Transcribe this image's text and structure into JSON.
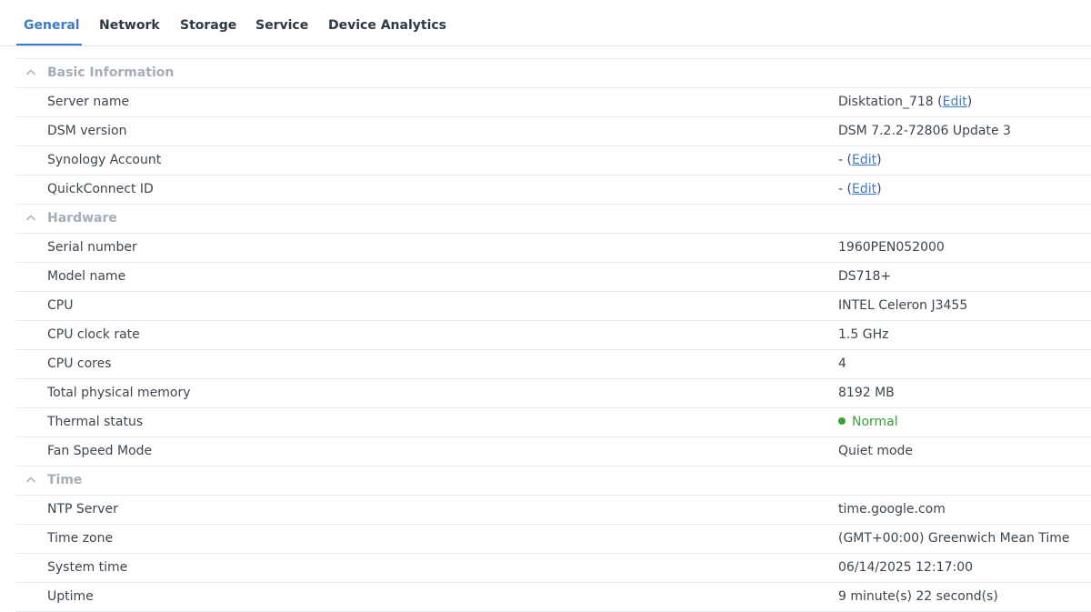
{
  "tabs": [
    {
      "label": "General",
      "active": true
    },
    {
      "label": "Network",
      "active": false
    },
    {
      "label": "Storage",
      "active": false
    },
    {
      "label": "Service",
      "active": false
    },
    {
      "label": "Device Analytics",
      "active": false
    }
  ],
  "icons": {
    "collapse": "chevron-up-icon",
    "status": "status-dot-icon"
  },
  "colors": {
    "accent": "#3d7bc4",
    "status_normal": "#3a9f3a",
    "section_title": "#a5adb5"
  },
  "sections": {
    "basic": {
      "title": "Basic Information",
      "rows": [
        {
          "label": "Server name",
          "value": "Disktation_718",
          "prefix": "(",
          "link": "Edit",
          "suffix": ")"
        },
        {
          "label": "DSM version",
          "value": "DSM 7.2.2-72806 Update 3"
        },
        {
          "label": "Synology Account",
          "value": "-",
          "prefix": "(",
          "link": "Edit",
          "suffix": ")"
        },
        {
          "label": "QuickConnect ID",
          "value": "-",
          "prefix": "(",
          "link": "Edit",
          "suffix": ")"
        }
      ]
    },
    "hardware": {
      "title": "Hardware",
      "rows": [
        {
          "label": "Serial number",
          "value": "1960PEN052000"
        },
        {
          "label": "Model name",
          "value": "DS718+"
        },
        {
          "label": "CPU",
          "value": "INTEL Celeron J3455"
        },
        {
          "label": "CPU clock rate",
          "value": "1.5 GHz"
        },
        {
          "label": "CPU cores",
          "value": "4"
        },
        {
          "label": "Total physical memory",
          "value": "8192 MB"
        },
        {
          "label": "Thermal status",
          "value": "Normal"
        },
        {
          "label": "Fan Speed Mode",
          "value": "Quiet mode"
        }
      ]
    },
    "time": {
      "title": "Time",
      "rows": [
        {
          "label": "NTP Server",
          "value": "time.google.com"
        },
        {
          "label": "Time zone",
          "value": "(GMT+00:00) Greenwich Mean Time"
        },
        {
          "label": "System time",
          "value": "06/14/2025 12:17:00"
        },
        {
          "label": "Uptime",
          "value": "9 minute(s) 22 second(s)"
        }
      ]
    }
  }
}
